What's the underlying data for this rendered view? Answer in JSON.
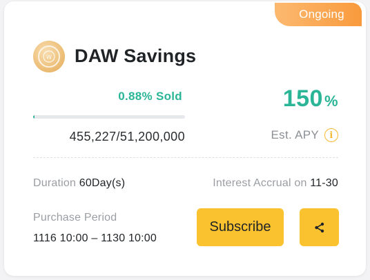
{
  "card": {
    "status_badge": "Ongoing",
    "product_name": "DAW Savings",
    "logo_icon": "daw-coin-logo",
    "sold": {
      "label": "0.88% Sold",
      "progress_fraction": 0.0088,
      "amount_text": "455,227/51,200,000"
    },
    "apy": {
      "value": "150",
      "unit": "%",
      "label": "Est. APY",
      "info_icon": "info-icon"
    },
    "duration": {
      "label": "Duration",
      "value": "60Day(s)"
    },
    "interest_accrual": {
      "label": "Interest Accrual on",
      "value": "11-30"
    },
    "purchase_period": {
      "label": "Purchase Period",
      "value": "1116 10:00 – 1130 10:00"
    },
    "actions": {
      "subscribe_label": "Subscribe",
      "share_icon": "share-icon"
    }
  },
  "colors": {
    "accent_green": "#2ab596",
    "button_yellow": "#fbc230",
    "badge_orange": "#f99a3c"
  }
}
